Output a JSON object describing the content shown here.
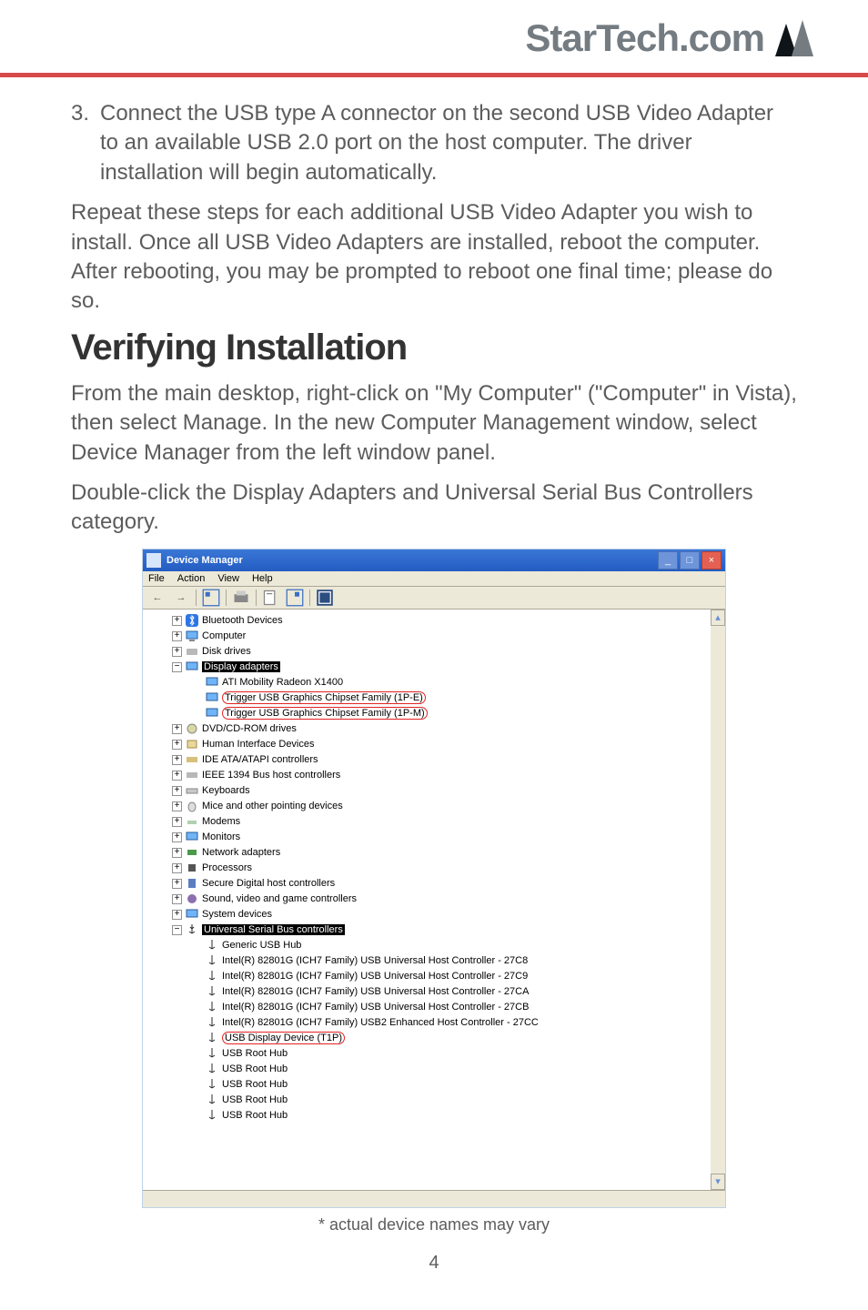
{
  "header": {
    "brand": "StarTech.com"
  },
  "step3": {
    "num": "3.",
    "text": "Connect the USB type A connector on the second USB Video Adapter to an available USB 2.0 port on the host computer. The driver installation will begin automatically."
  },
  "repeat_para": "Repeat these steps for each additional USB Video Adapter you wish to install. Once all USB Video Adapters are installed, reboot the computer. After rebooting, you may be prompted to reboot one final time; please do so.",
  "heading": "Verifying Installation",
  "verify_para1": "From the main desktop, right-click on \"My Computer\" (\"Computer\" in Vista), then select Manage. In the new Computer Management window, select Device Manager from the left window panel.",
  "verify_para2": "Double-click the Display Adapters and Universal Serial Bus Controllers category.",
  "devmgr": {
    "title": "Device Manager",
    "menus": [
      "File",
      "Action",
      "View",
      "Help"
    ],
    "tree": {
      "bluetooth": "Bluetooth Devices",
      "computer": "Computer",
      "disk": "Disk drives",
      "display": "Display adapters",
      "display_children": [
        "ATI Mobility Radeon X1400",
        "Trigger USB Graphics Chipset Family (1P-E)",
        "Trigger USB Graphics Chipset Family (1P-M)"
      ],
      "dvd": "DVD/CD-ROM drives",
      "hid": "Human Interface Devices",
      "ide": "IDE ATA/ATAPI controllers",
      "ieee": "IEEE 1394 Bus host controllers",
      "keyboards": "Keyboards",
      "mice": "Mice and other pointing devices",
      "modems": "Modems",
      "monitors": "Monitors",
      "network": "Network adapters",
      "processors": "Processors",
      "sdhost": "Secure Digital host controllers",
      "sound": "Sound, video and game controllers",
      "system": "System devices",
      "usb": "Universal Serial Bus controllers",
      "usb_children": [
        "Generic USB Hub",
        "Intel(R) 82801G (ICH7 Family) USB Universal Host Controller - 27C8",
        "Intel(R) 82801G (ICH7 Family) USB Universal Host Controller - 27C9",
        "Intel(R) 82801G (ICH7 Family) USB Universal Host Controller - 27CA",
        "Intel(R) 82801G (ICH7 Family) USB Universal Host Controller - 27CB",
        "Intel(R) 82801G (ICH7 Family) USB2 Enhanced Host Controller - 27CC",
        "USB Display Device (T1P)",
        "USB Root Hub",
        "USB Root Hub",
        "USB Root Hub",
        "USB Root Hub",
        "USB Root Hub"
      ]
    }
  },
  "caption": "* actual device names may vary",
  "pagenum": "4"
}
